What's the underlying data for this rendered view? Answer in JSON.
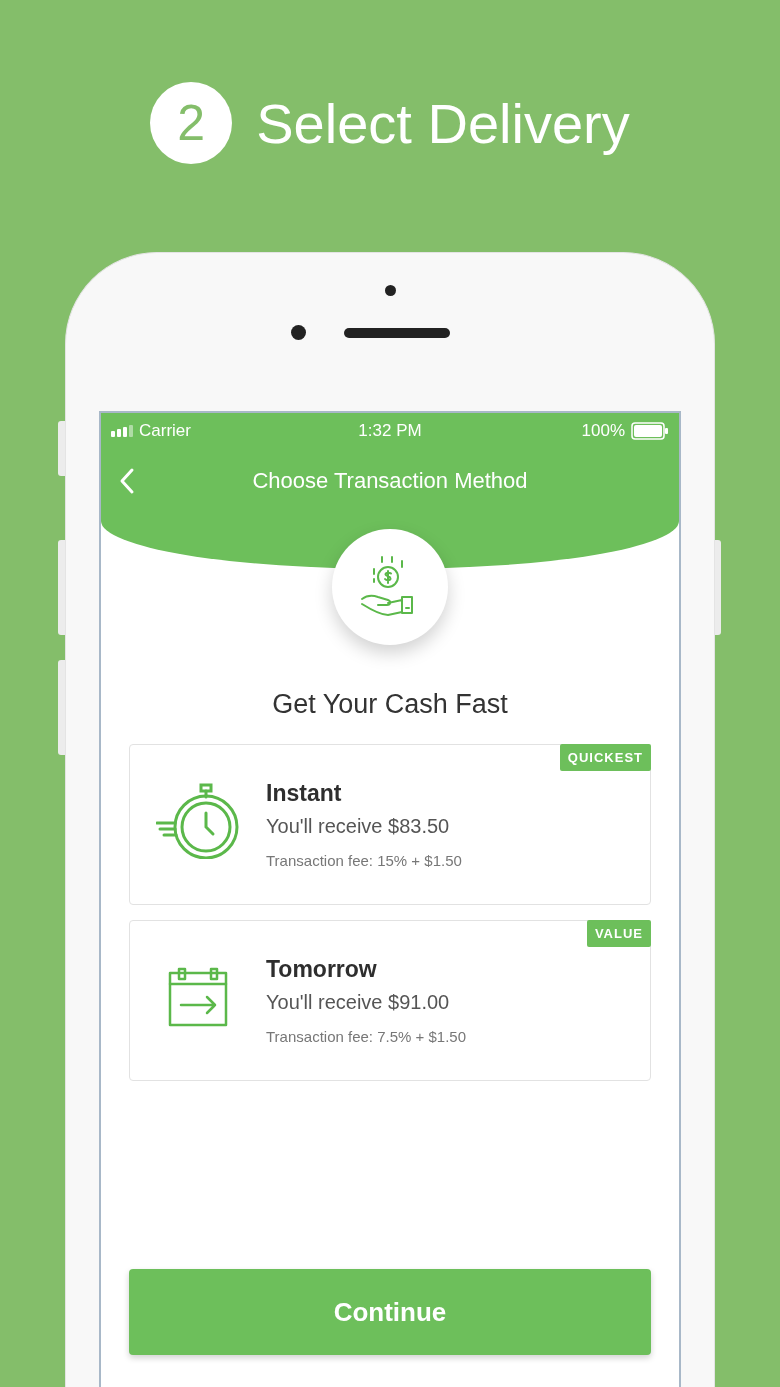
{
  "headline": {
    "step": "2",
    "title": "Select Delivery"
  },
  "status_bar": {
    "carrier": "Carrier",
    "time": "1:32 PM",
    "battery": "100%"
  },
  "nav": {
    "title": "Choose Transaction Method"
  },
  "heading": "Get Your Cash Fast",
  "options": [
    {
      "kind": "stopwatch",
      "badge": "QUICKEST",
      "title": "Instant",
      "receive": "You'll receive $83.50",
      "fee": "Transaction fee: 15% + $1.50"
    },
    {
      "kind": "calendar",
      "badge": "VALUE",
      "title": "Tomorrow",
      "receive": "You'll receive $91.00",
      "fee": "Transaction fee: 7.5% + $1.50"
    }
  ],
  "button": "Continue"
}
